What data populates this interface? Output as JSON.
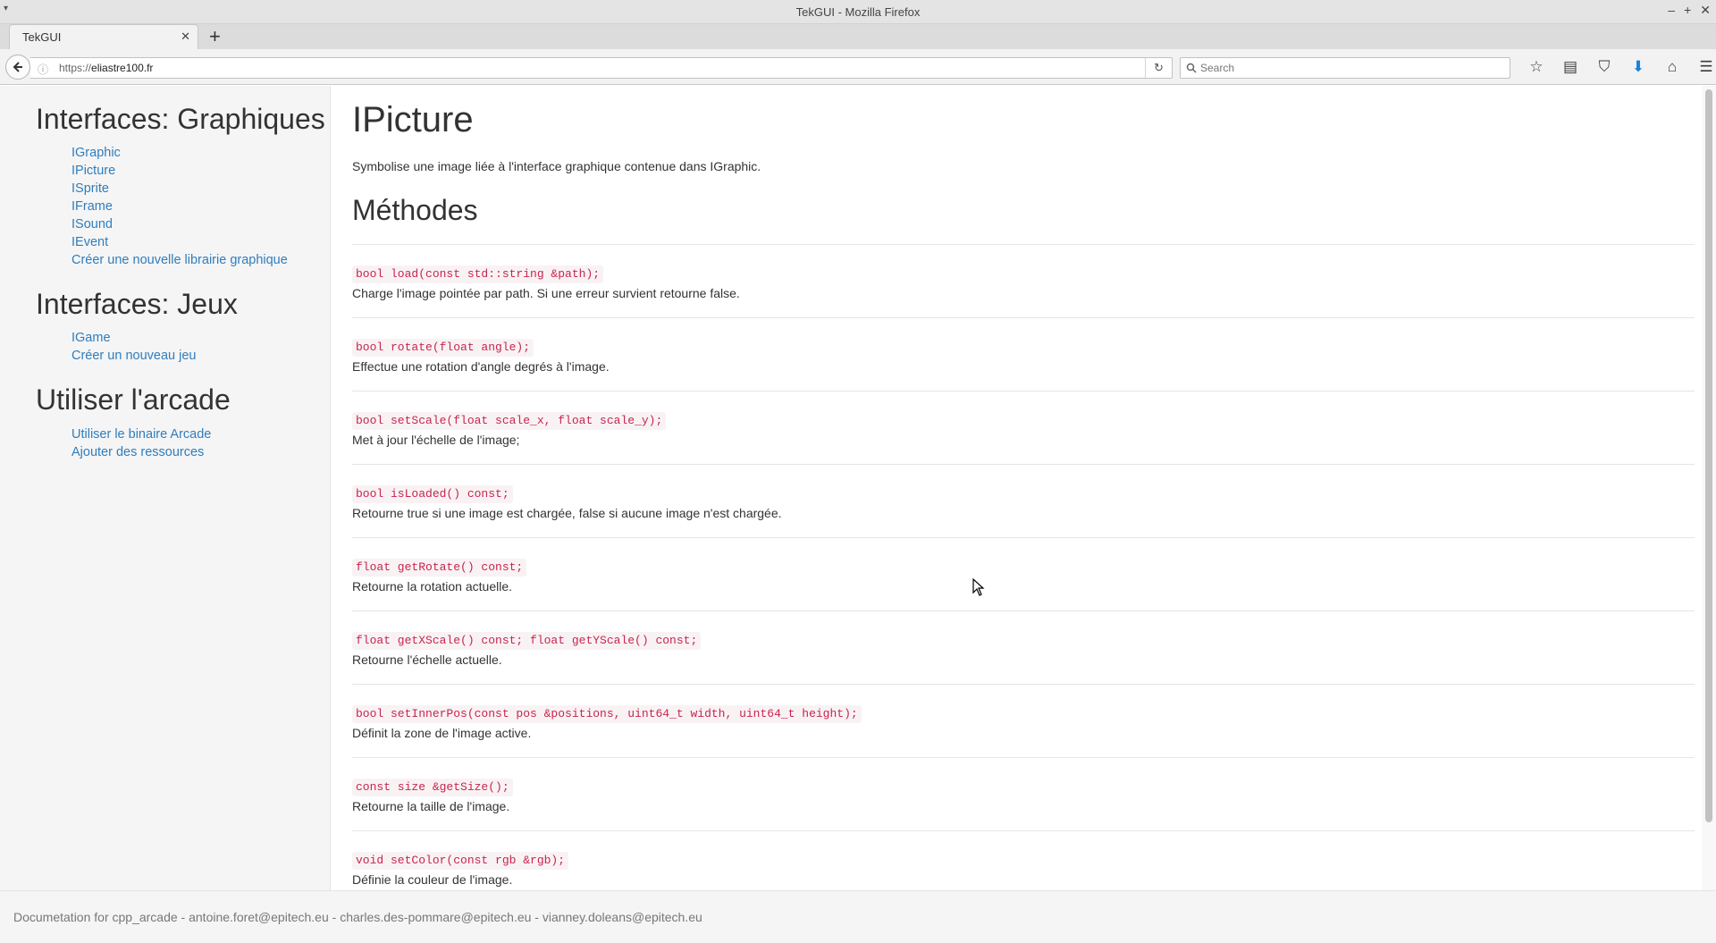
{
  "window": {
    "title": "TekGUI - Mozilla Firefox",
    "menu_glyph": "▾",
    "controls": [
      "–",
      "+",
      "✕"
    ]
  },
  "tabs": [
    {
      "title": "TekGUI",
      "close": "✕"
    }
  ],
  "newtab_glyph": "+",
  "navbar": {
    "url_prefix": "https://",
    "url_host": "eliastre100.fr",
    "search_placeholder": "Search"
  },
  "sidebar": {
    "sections": [
      {
        "title": "Interfaces: Graphiques",
        "items": [
          "IGraphic",
          "IPicture",
          "ISprite",
          "IFrame",
          "ISound",
          "IEvent",
          "Créer une nouvelle librairie graphique"
        ]
      },
      {
        "title": "Interfaces: Jeux",
        "items": [
          "IGame",
          "Créer un nouveau jeu"
        ]
      },
      {
        "title": "Utiliser l'arcade",
        "items": [
          "Utiliser le binaire Arcade",
          "Ajouter des ressources"
        ]
      }
    ]
  },
  "main": {
    "title": "IPicture",
    "description": "Symbolise une image liée à l'interface graphique contenue dans IGraphic.",
    "methods_title": "Méthodes",
    "methods": [
      {
        "signature": "bool load(const std::string &path);",
        "description": "Charge l'image pointée par path. Si une erreur survient retourne false."
      },
      {
        "signature": "bool rotate(float angle);",
        "description": "Effectue une rotation d'angle degrés à l'image."
      },
      {
        "signature": "bool setScale(float scale_x, float scale_y);",
        "description": "Met à jour l'échelle de l'image;"
      },
      {
        "signature": "bool isLoaded() const;",
        "description": "Retourne true si une image est chargée, false si aucune image n'est chargée."
      },
      {
        "signature": "float getRotate() const;",
        "description": "Retourne la rotation actuelle."
      },
      {
        "signature": "float getXScale() const; float getYScale() const;",
        "description": "Retourne l'échelle actuelle."
      },
      {
        "signature": "bool setInnerPos(const pos &positions, uint64_t width, uint64_t height);",
        "description": "Définit la zone de l'image active."
      },
      {
        "signature": "const size &getSize();",
        "description": "Retourne la taille de l'image."
      },
      {
        "signature": "void setColor(const rgb &rgb);",
        "description": "Définie la couleur de l'image."
      }
    ]
  },
  "footer": {
    "text": "Documetation for cpp_arcade - antoine.foret@epitech.eu - charles.des-pommare@epitech.eu - vianney.doleans@epitech.eu"
  },
  "colors": {
    "link": "#2f7dbd",
    "code": "#c7254e",
    "code_bg": "#f9f2f4",
    "download_icon": "#1a7fdc"
  }
}
